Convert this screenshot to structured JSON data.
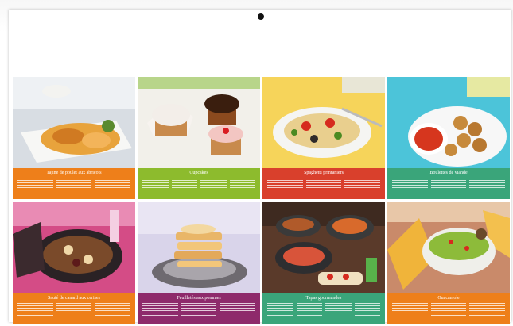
{
  "poster": {
    "title": "",
    "pin_icon": "pin-icon"
  },
  "colors": {
    "orange": "#ee7f1a",
    "green": "#8dbb2d",
    "red": "#d9402c",
    "teal": "#3aa57a",
    "plum": "#8e2a6b",
    "magenta": "#c0407f"
  },
  "cards": [
    {
      "title": "Tajine de poulet aux abricots",
      "subtitle": "",
      "color": "#ee7f1a"
    },
    {
      "title": "Cupcakes",
      "subtitle": "",
      "color": "#8dbb2d"
    },
    {
      "title": "Spaghetti printaniers",
      "subtitle": "",
      "color": "#d9402c"
    },
    {
      "title": "Boulettes de viande",
      "subtitle": "",
      "color": "#3aa57a"
    },
    {
      "title": "Sauté de canard aux cerises",
      "subtitle": "",
      "color": "#ee7f1a"
    },
    {
      "title": "Feuilletés aux pommes",
      "subtitle": "",
      "color": "#8e2a6b"
    },
    {
      "title": "Tapas gourmandes",
      "subtitle": "",
      "color": "#3aa57a"
    },
    {
      "title": "Guacamole",
      "subtitle": "",
      "color": "#ee7f1a"
    }
  ]
}
